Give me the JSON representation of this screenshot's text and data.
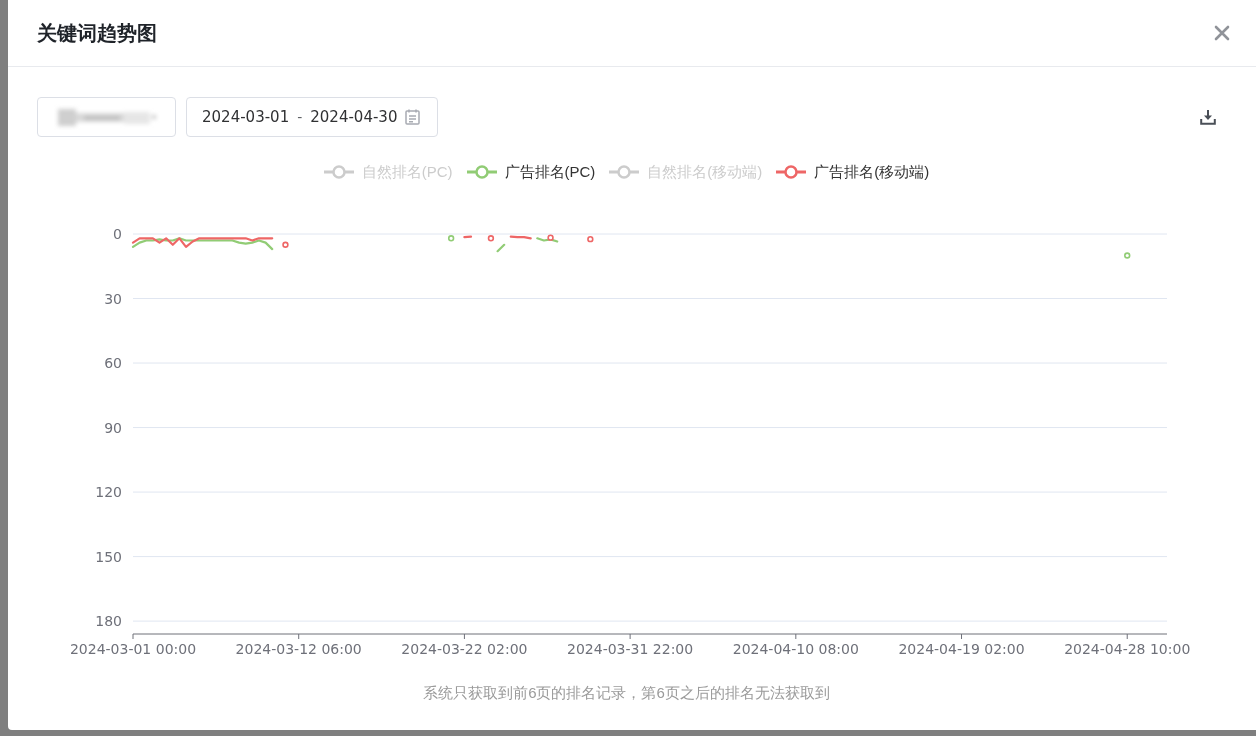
{
  "dialog": {
    "title": "关键词趋势图"
  },
  "date_range": {
    "start": "2024-03-01",
    "separator": "-",
    "end": "2024-04-30"
  },
  "legend": [
    {
      "label": "自然排名(PC)",
      "selected": false
    },
    {
      "selected": true
    },
    {
      "label": "自然排名(移动端)",
      "selected": false
    },
    {
      "selected": true
    }
  ],
  "chart": {
    "chart_data": {
      "type": "line",
      "grid": true,
      "ylim": [
        186,
        0
      ],
      "yticks": [
        0,
        30,
        60,
        90,
        120,
        150,
        180
      ],
      "categories": [
        "2024-03-01 00:00",
        null,
        null,
        null,
        null,
        null,
        null,
        null,
        null,
        null,
        null,
        null,
        null,
        null,
        null,
        null,
        null,
        null,
        null,
        null,
        null,
        null,
        null,
        null,
        null,
        "2024-03-12 06:00",
        null,
        null,
        null,
        null,
        null,
        null,
        null,
        null,
        null,
        null,
        null,
        null,
        null,
        null,
        null,
        null,
        null,
        null,
        null,
        null,
        null,
        null,
        null,
        null,
        "2024-03-22 02:00",
        null,
        null,
        null,
        null,
        null,
        null,
        null,
        null,
        null,
        null,
        null,
        null,
        null,
        null,
        null,
        null,
        null,
        null,
        null,
        null,
        null,
        null,
        null,
        null,
        "2024-03-31 22:00",
        null,
        null,
        null,
        null,
        null,
        null,
        null,
        null,
        null,
        null,
        null,
        null,
        null,
        null,
        null,
        null,
        null,
        null,
        null,
        null,
        null,
        null,
        null,
        null,
        "2024-04-10 08:00",
        null,
        null,
        null,
        null,
        null,
        null,
        null,
        null,
        null,
        null,
        null,
        null,
        null,
        null,
        null,
        null,
        null,
        null,
        null,
        null,
        null,
        null,
        null,
        null,
        "2024-04-19 02:00",
        null,
        null,
        null,
        null,
        null,
        null,
        null,
        null,
        null,
        null,
        null,
        null,
        null,
        null,
        null,
        null,
        null,
        null,
        null,
        null,
        null,
        null,
        null,
        null,
        "2024-04-28 10:00",
        null,
        null,
        null,
        null,
        null,
        null
      ],
      "series": [
        {
          "name": "广告排名(PC)",
          "color": "#91cc75",
          "values": [
            6,
            4,
            3,
            3,
            2.5,
            3,
            3,
            2,
            3,
            3,
            3,
            3,
            3,
            3,
            3,
            3,
            4,
            4.5,
            4,
            3,
            4,
            7,
            null,
            null,
            null,
            null,
            null,
            null,
            null,
            null,
            null,
            null,
            null,
            null,
            null,
            null,
            null,
            null,
            null,
            null,
            null,
            null,
            null,
            null,
            null,
            null,
            null,
            null,
            2,
            null,
            null,
            null,
            null,
            null,
            null,
            8,
            5,
            null,
            null,
            null,
            null,
            2,
            3,
            2.5,
            3.5,
            null,
            null,
            null,
            null,
            null,
            null,
            null,
            null,
            null,
            null,
            null,
            null,
            null,
            null,
            null,
            null,
            null,
            null,
            null,
            null,
            null,
            null,
            null,
            null,
            null,
            null,
            null,
            null,
            null,
            null,
            null,
            null,
            null,
            null,
            null,
            null,
            null,
            null,
            null,
            null,
            null,
            null,
            null,
            null,
            null,
            null,
            null,
            null,
            null,
            null,
            null,
            null,
            null,
            null,
            null,
            null,
            null,
            null,
            null,
            null,
            null,
            null,
            null,
            null,
            null,
            null,
            null,
            null,
            null,
            null,
            null,
            null,
            null,
            null,
            null,
            null,
            null,
            null,
            null,
            null,
            null,
            null,
            null,
            null,
            null,
            10,
            null,
            null,
            null,
            null,
            null,
            null
          ]
        },
        {
          "name": "广告排名(移动端)",
          "color": "#ee6666",
          "values": [
            4,
            2,
            2,
            2,
            4,
            2,
            5,
            2,
            6,
            3.5,
            2,
            2,
            2,
            2,
            2,
            2,
            2,
            2,
            3,
            2,
            2,
            2,
            null,
            5,
            null,
            null,
            null,
            null,
            null,
            null,
            null,
            null,
            null,
            null,
            null,
            null,
            null,
            null,
            null,
            null,
            null,
            null,
            null,
            null,
            null,
            null,
            null,
            null,
            null,
            null,
            1.5,
            1.2,
            null,
            null,
            2,
            null,
            null,
            1.2,
            1.5,
            1.5,
            2,
            null,
            null,
            1.7,
            null,
            null,
            null,
            null,
            null,
            2.4,
            null,
            null,
            null,
            null,
            null,
            null,
            null,
            null,
            null,
            null,
            null,
            null,
            null,
            null,
            null,
            null,
            null,
            null,
            null,
            null,
            null,
            null,
            null,
            null,
            null,
            null,
            null,
            null,
            null,
            null,
            null,
            null,
            null,
            null,
            null,
            null,
            null,
            null,
            null,
            null,
            null,
            null,
            null,
            null,
            null,
            null,
            null,
            null,
            null,
            null,
            null,
            null,
            null,
            null,
            null,
            null,
            null,
            null,
            null,
            null,
            null,
            null,
            null,
            null,
            null,
            null,
            null,
            null,
            null,
            null,
            null,
            null,
            null,
            null,
            null,
            null,
            null,
            null,
            null,
            null,
            null,
            null,
            null,
            null,
            null,
            null,
            null
          ]
        }
      ]
    }
  },
  "footnote": "系统只获取到前6页的排名记录，第6页之后的排名无法获取到"
}
